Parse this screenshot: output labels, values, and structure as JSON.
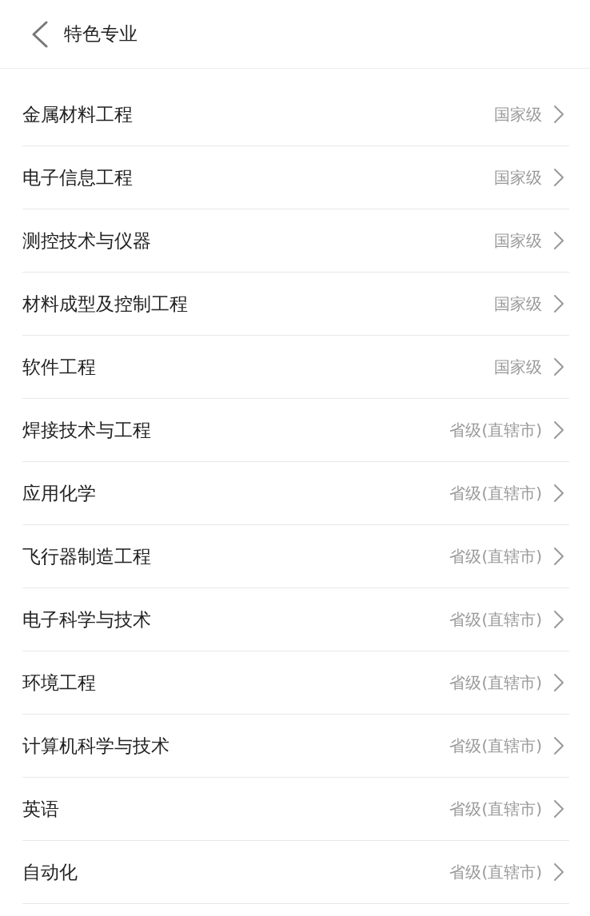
{
  "header": {
    "title": "特色专业"
  },
  "majors": [
    {
      "name": "金属材料工程",
      "level": "国家级"
    },
    {
      "name": "电子信息工程",
      "level": "国家级"
    },
    {
      "name": "测控技术与仪器",
      "level": "国家级"
    },
    {
      "name": "材料成型及控制工程",
      "level": "国家级"
    },
    {
      "name": "软件工程",
      "level": "国家级"
    },
    {
      "name": "焊接技术与工程",
      "level": "省级(直辖市)"
    },
    {
      "name": "应用化学",
      "level": "省级(直辖市)"
    },
    {
      "name": "飞行器制造工程",
      "level": "省级(直辖市)"
    },
    {
      "name": "电子科学与技术",
      "level": "省级(直辖市)"
    },
    {
      "name": "环境工程",
      "level": "省级(直辖市)"
    },
    {
      "name": "计算机科学与技术",
      "level": "省级(直辖市)"
    },
    {
      "name": "英语",
      "level": "省级(直辖市)"
    },
    {
      "name": "自动化",
      "level": "省级(直辖市)"
    }
  ]
}
